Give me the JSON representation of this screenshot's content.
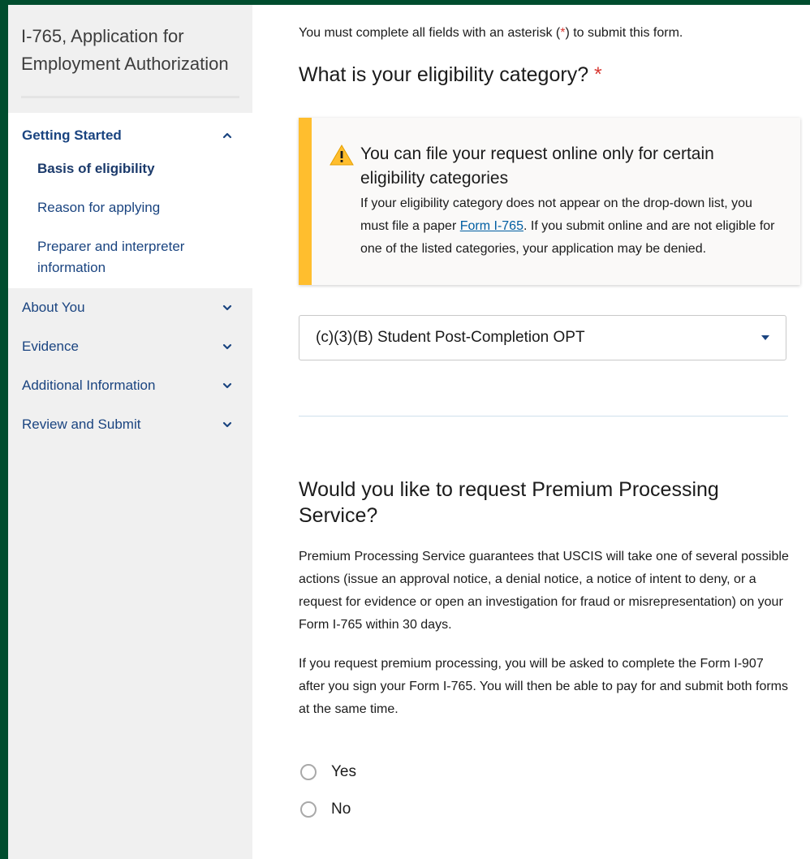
{
  "sidebar": {
    "title": "I-765, Application for Employment Authorization",
    "sections": [
      {
        "label": "Getting Started",
        "expanded": true,
        "items": [
          {
            "label": "Basis of eligibility",
            "active": true
          },
          {
            "label": "Reason for applying",
            "active": false
          },
          {
            "label": "Preparer and interpreter information",
            "active": false
          }
        ]
      },
      {
        "label": "About You",
        "expanded": false
      },
      {
        "label": "Evidence",
        "expanded": false
      },
      {
        "label": "Additional Information",
        "expanded": false
      },
      {
        "label": "Review and Submit",
        "expanded": false
      }
    ]
  },
  "main": {
    "required_note_pre": "You must complete all fields with an asterisk (",
    "required_note_ast": "*",
    "required_note_post": ") to submit this form.",
    "eligibility_question": "What is your eligibility category?",
    "required_marker": "*",
    "alert": {
      "heading": "You can file your request online only for certain eligibility categories",
      "body_pre": "If your eligibility category does not appear on the drop-down list, you must file a paper ",
      "link_text": "Form I-765",
      "body_post": ". If you submit online and are not eligible for one of the listed categories, your application may be denied."
    },
    "eligibility_select_value": "(c)(3)(B) Student Post-Completion OPT",
    "premium_question": "Would you like to request Premium Processing Service?",
    "premium_para1": "Premium Processing Service guarantees that USCIS will take one of several possible actions (issue an approval notice, a denial notice, a notice of intent to deny, or a request for evidence or open an investigation for fraud or misrepresentation) on your Form I-765 within 30 days.",
    "premium_para2": "If you request premium processing, you will be asked to complete the Form I-907 after you sign your Form I-765. You will then be able to pay for and submit both forms at the same time.",
    "radio_yes": "Yes",
    "radio_no": "No"
  },
  "colors": {
    "frame_border": "#004d2e",
    "link": "#1a4480",
    "warning": "#ffbe2e",
    "required": "#d83933"
  },
  "icons": {
    "warning": "warning-triangle-icon",
    "expand_up": "chevron-up-icon",
    "expand_down": "chevron-down-icon",
    "select_caret": "caret-down-icon"
  }
}
